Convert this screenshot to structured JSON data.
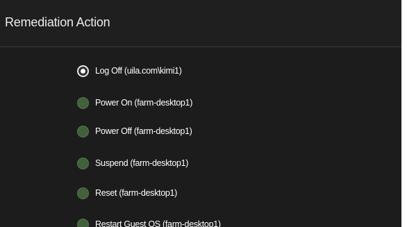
{
  "panel": {
    "title": "Remediation Action"
  },
  "options": [
    {
      "label": "Log Off (uila.com\\kimi1)",
      "selected": true
    },
    {
      "label": "Power On (farm-desktop1)",
      "selected": false
    },
    {
      "label": "Power Off (farm-desktop1)",
      "selected": false
    },
    {
      "label": "Suspend (farm-desktop1)",
      "selected": false
    },
    {
      "label": "Reset (farm-desktop1)",
      "selected": false
    },
    {
      "label": "Restart Guest OS (farm-desktop1)",
      "selected": false
    }
  ],
  "colors": {
    "background": "#1c1c1c",
    "radio_unselected": "#41603b",
    "radio_selected_ring": "#e6e6e6",
    "text": "#ffffff"
  }
}
